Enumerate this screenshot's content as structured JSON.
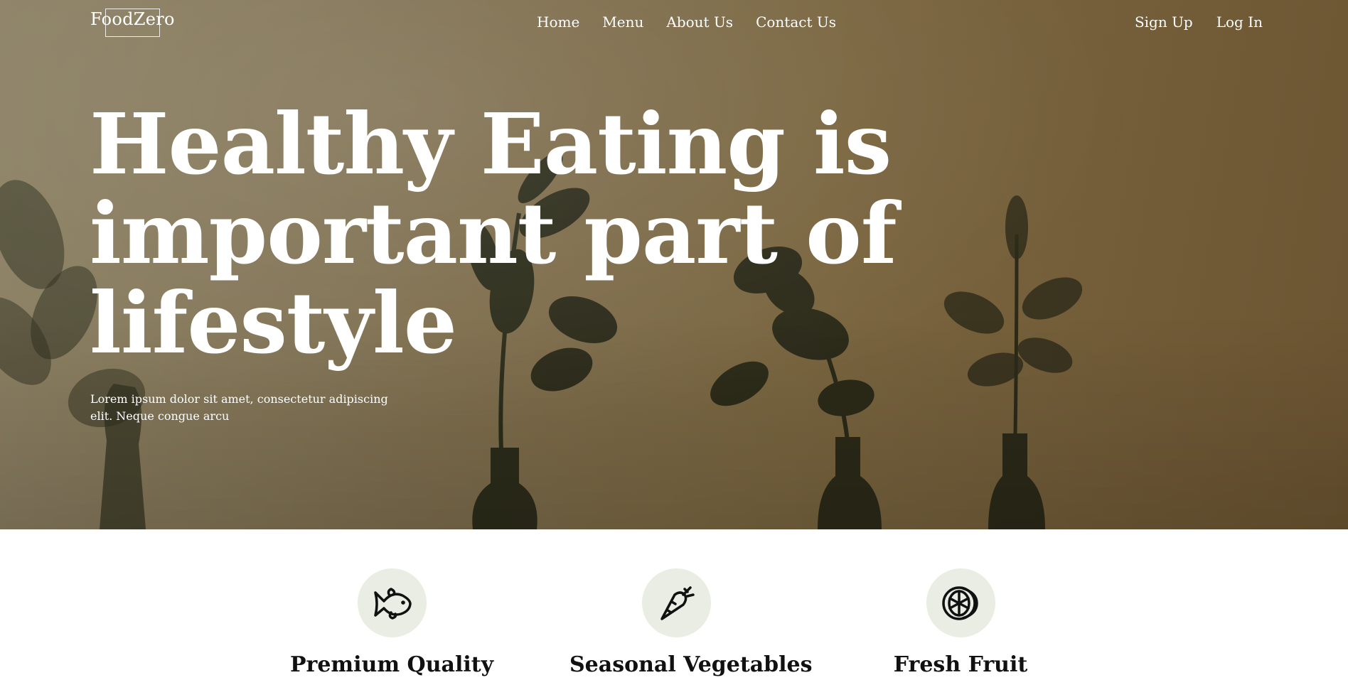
{
  "brand": {
    "name": "FoodZero"
  },
  "nav": {
    "items": [
      "Home",
      "Menu",
      "About Us",
      "Contact Us"
    ]
  },
  "auth": {
    "signup": "Sign Up",
    "login": "Log In"
  },
  "hero": {
    "headline": "Healthy Eating is important part of lifestyle",
    "subtext": "Lorem ipsum dolor sit amet, consectetur adipiscing elit. Neque congue arcu"
  },
  "features": [
    {
      "title": "Premium Quality",
      "icon": "fish-icon"
    },
    {
      "title": "Seasonal Vegetables",
      "icon": "carrot-icon"
    },
    {
      "title": "Fresh Fruit",
      "icon": "citrus-icon"
    }
  ],
  "colors": {
    "hero_bg": "#7a6640",
    "icon_circle": "#e9ede3",
    "heading_text": "#111111",
    "hero_text": "#ffffff"
  }
}
